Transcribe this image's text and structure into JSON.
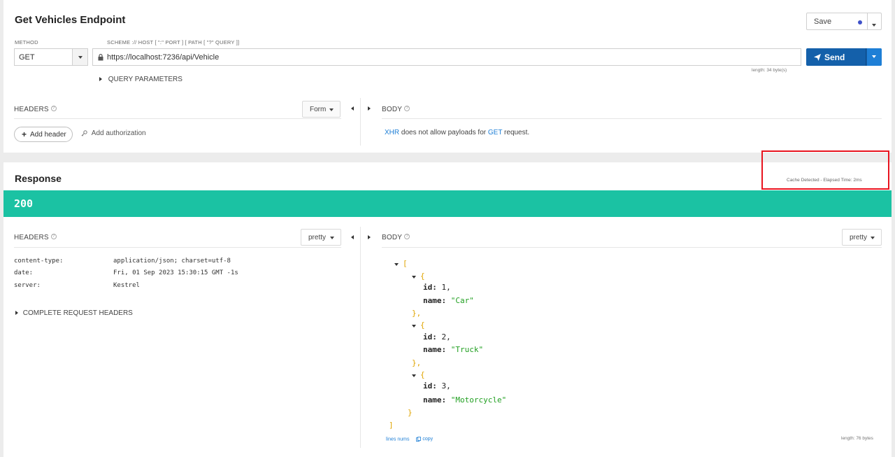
{
  "request": {
    "title": "Get Vehicles Endpoint",
    "method_label": "METHOD",
    "method_value": "GET",
    "scheme_label": "SCHEME :// HOST [ \":\" PORT ] [ PATH [ \"?\" QUERY ]]",
    "url": "https://localhost:7236/api/Vehicle",
    "length_info": "length: 34 byte(s)",
    "save_label": "Save",
    "send_label": "Send",
    "query_params_label": "QUERY PARAMETERS",
    "headers_label": "HEADERS",
    "form_label": "Form",
    "add_header_label": "Add header",
    "add_auth_label": "Add authorization",
    "body_label": "BODY",
    "body_note": {
      "xhr": "XHR",
      "middle": "does not allow payloads for",
      "get": "GET",
      "end": "request."
    }
  },
  "response": {
    "title": "Response",
    "cache_info": "Cache Detected - Elapsed Time: 2ms",
    "status": "200",
    "headers_label": "HEADERS",
    "pretty_label": "pretty",
    "body_label": "BODY",
    "headers": [
      {
        "name": "content-type:",
        "value": "application/json; charset=utf-8"
      },
      {
        "name": "date:",
        "value": "Fri, 01 Sep 2023 15:30:15 GMT -1s"
      },
      {
        "name": "server:",
        "value": "Kestrel"
      }
    ],
    "complete_headers_label": "COMPLETE REQUEST HEADERS",
    "body": [
      {
        "id": "1",
        "name": "\"Car\""
      },
      {
        "id": "2",
        "name": "\"Truck\""
      },
      {
        "id": "3",
        "name": "\"Motorcycle\""
      }
    ],
    "lines_nums_label": "lines nums",
    "copy_label": "copy",
    "length_info": "length: 76 bytes"
  },
  "colors": {
    "status_bar": "#1bc2a3",
    "send_button": "#1460aa",
    "highlight": "#e8141f"
  }
}
